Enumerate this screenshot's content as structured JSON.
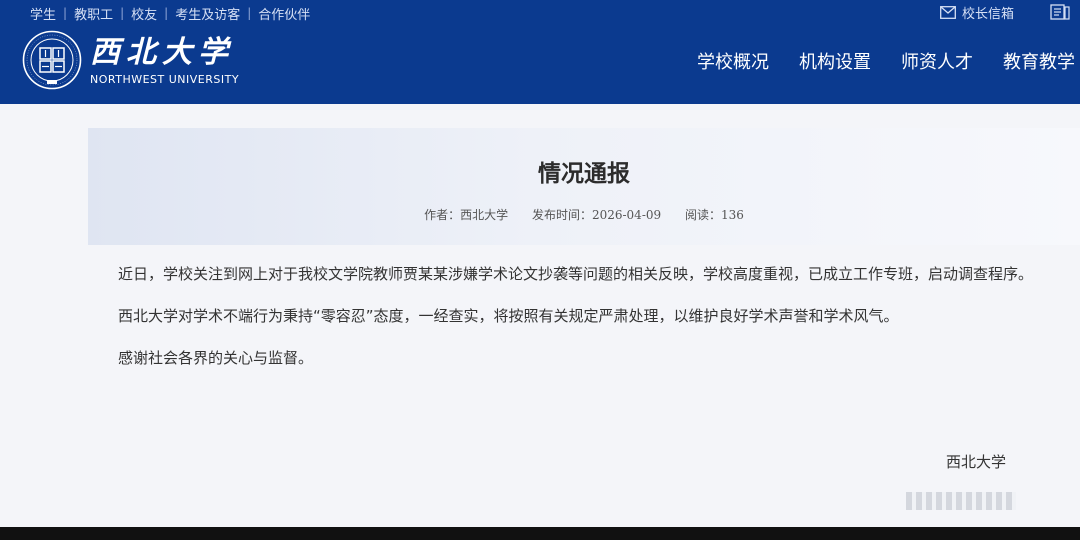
{
  "header": {
    "top_links": [
      "学生",
      "教职工",
      "校友",
      "考生及访客",
      "合作伙伴"
    ],
    "mailbox": "校长信箱",
    "logo_cn": "西北大学",
    "logo_en": "NORTHWEST UNIVERSITY",
    "nav": [
      "学校概况",
      "机构设置",
      "师资人才",
      "教育教学"
    ]
  },
  "article": {
    "title": "情况通报",
    "author": "作者：西北大学",
    "date": "发布时间：2026-04-09",
    "reads": "阅读：136",
    "paragraphs": [
      "近日，学校关注到网上对于我校文学院教师贾某某涉嫌学术论文抄袭等问题的相关反映，学校高度重视，已成立工作专班，启动调查程序。",
      "西北大学对学术不端行为秉持“零容忍”态度，一经查实，将按照有关规定严肃处理，以维护良好学术声誉和学术风气。",
      "感谢社会各界的关心与监督。"
    ],
    "signature": "西北大学"
  },
  "colors": {
    "header_bg": "#0b3a8f",
    "title_box": "#dfe5f2"
  }
}
